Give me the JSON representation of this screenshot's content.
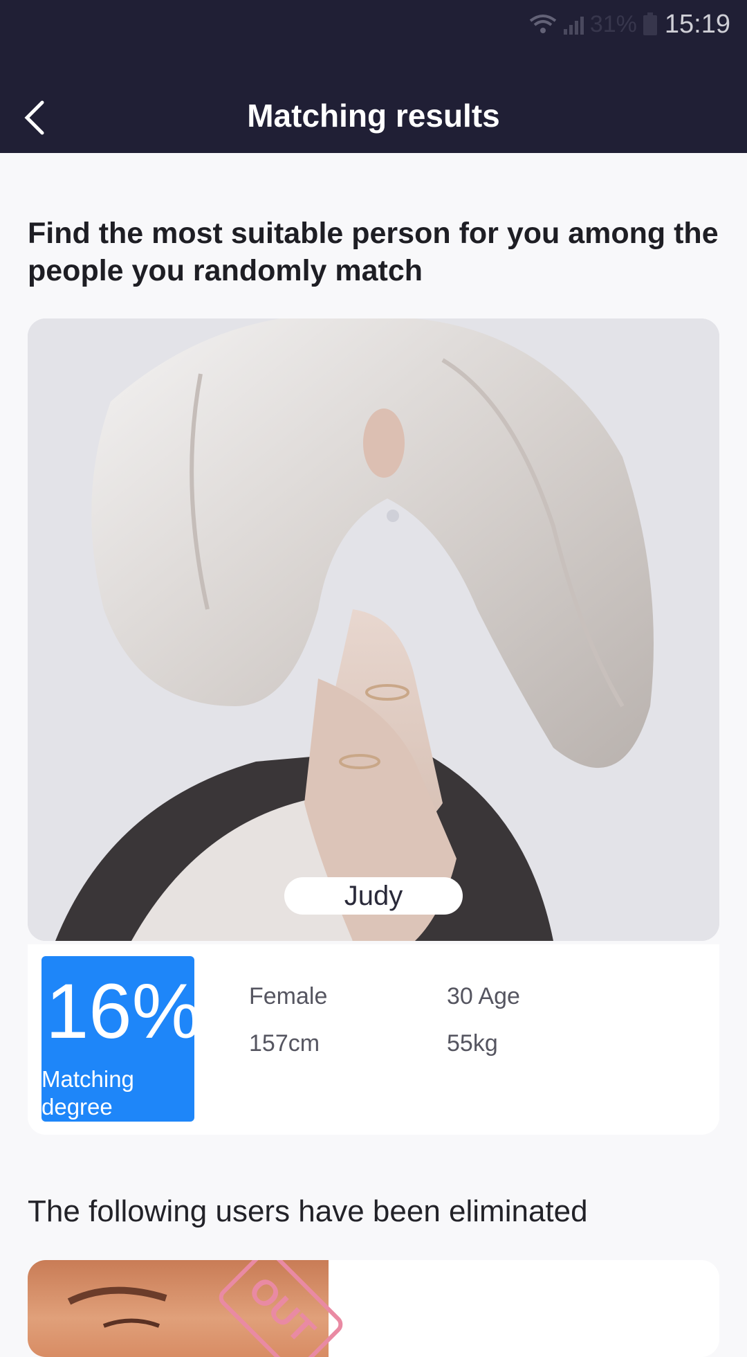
{
  "status_bar": {
    "time": "15:19",
    "battery_text": "31%"
  },
  "header": {
    "title": "Matching results",
    "back_icon": "chevron-left-icon"
  },
  "intro": {
    "text": "Find the most suitable person for you among the people you randomly match"
  },
  "match": {
    "name": "Judy",
    "percent": "16%",
    "percent_value": 16,
    "label": "Matching degree",
    "gender": "Female",
    "age": "30 Age",
    "height": "157cm",
    "weight": "55kg"
  },
  "eliminated": {
    "title": "The following users have been eliminated",
    "badge": "OUT"
  },
  "colors": {
    "header_bg": "#201f35",
    "accent": "#1e86f9"
  }
}
